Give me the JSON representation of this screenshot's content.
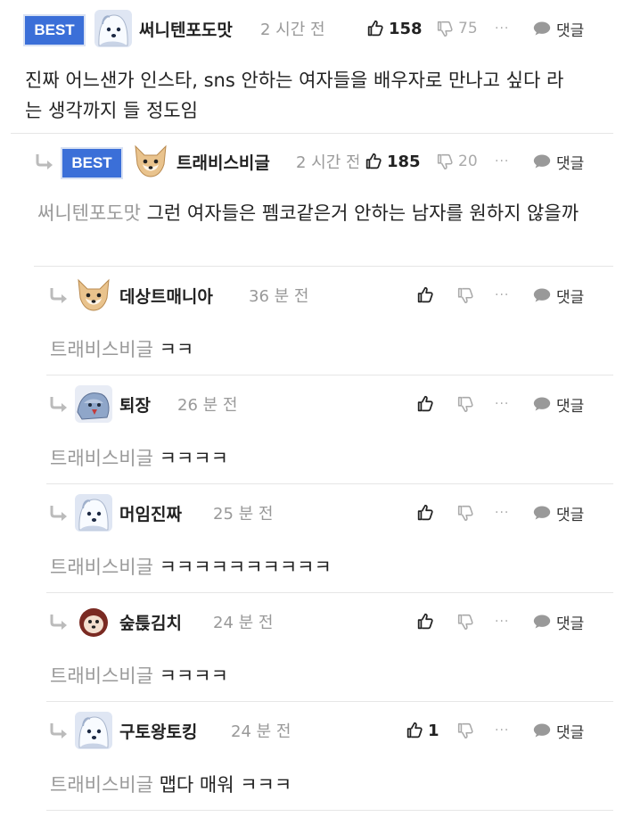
{
  "comments": [
    {
      "best": "BEST",
      "nickname": "써니텐포도맛",
      "time": "2 시간 전",
      "likes": "158",
      "dislikes": "75",
      "more": "···",
      "reply_label": "댓글",
      "text": "진짜 어느샌가 인스타, sns 안하는 여자들을 배우자로 만나고 싶다 라는 생각까지 들 정도임",
      "avatar": "white-dog"
    },
    {
      "best": "BEST",
      "nickname": "트래비스비글",
      "time": "2 시간 전",
      "likes": "185",
      "dislikes": "20",
      "more": "···",
      "reply_label": "댓글",
      "mention": "써니텐포도맛",
      "text": "그런 여자들은 펨코같은거 안하는 남자를 원하지 않을까",
      "avatar": "shiba"
    },
    {
      "nickname": "데상트매니아",
      "time": "36 분 전",
      "more": "···",
      "reply_label": "댓글",
      "mention": "트래비스비글",
      "text": "ㅋㅋ",
      "avatar": "shiba"
    },
    {
      "nickname": "퇴장",
      "time": "26 분 전",
      "more": "···",
      "reply_label": "댓글",
      "mention": "트래비스비글",
      "text": "ㅋㅋㅋㅋ",
      "avatar": "bird"
    },
    {
      "nickname": "머임진짜",
      "time": "25 분 전",
      "more": "···",
      "reply_label": "댓글",
      "mention": "트래비스비글",
      "text": "ㅋㅋㅋㅋㅋㅋㅋㅋㅋㅋ",
      "avatar": "white-dog"
    },
    {
      "nickname": "숲튽김치",
      "time": "24 분 전",
      "more": "···",
      "reply_label": "댓글",
      "mention": "트래비스비글",
      "text": "ㅋㅋㅋㅋ",
      "avatar": "red-dog"
    },
    {
      "nickname": "구토왕토킹",
      "time": "24 분 전",
      "likes": "1",
      "more": "···",
      "reply_label": "댓글",
      "mention": "트래비스비글",
      "text": "맵다 매워 ㅋㅋㅋ",
      "avatar": "white-dog"
    }
  ]
}
